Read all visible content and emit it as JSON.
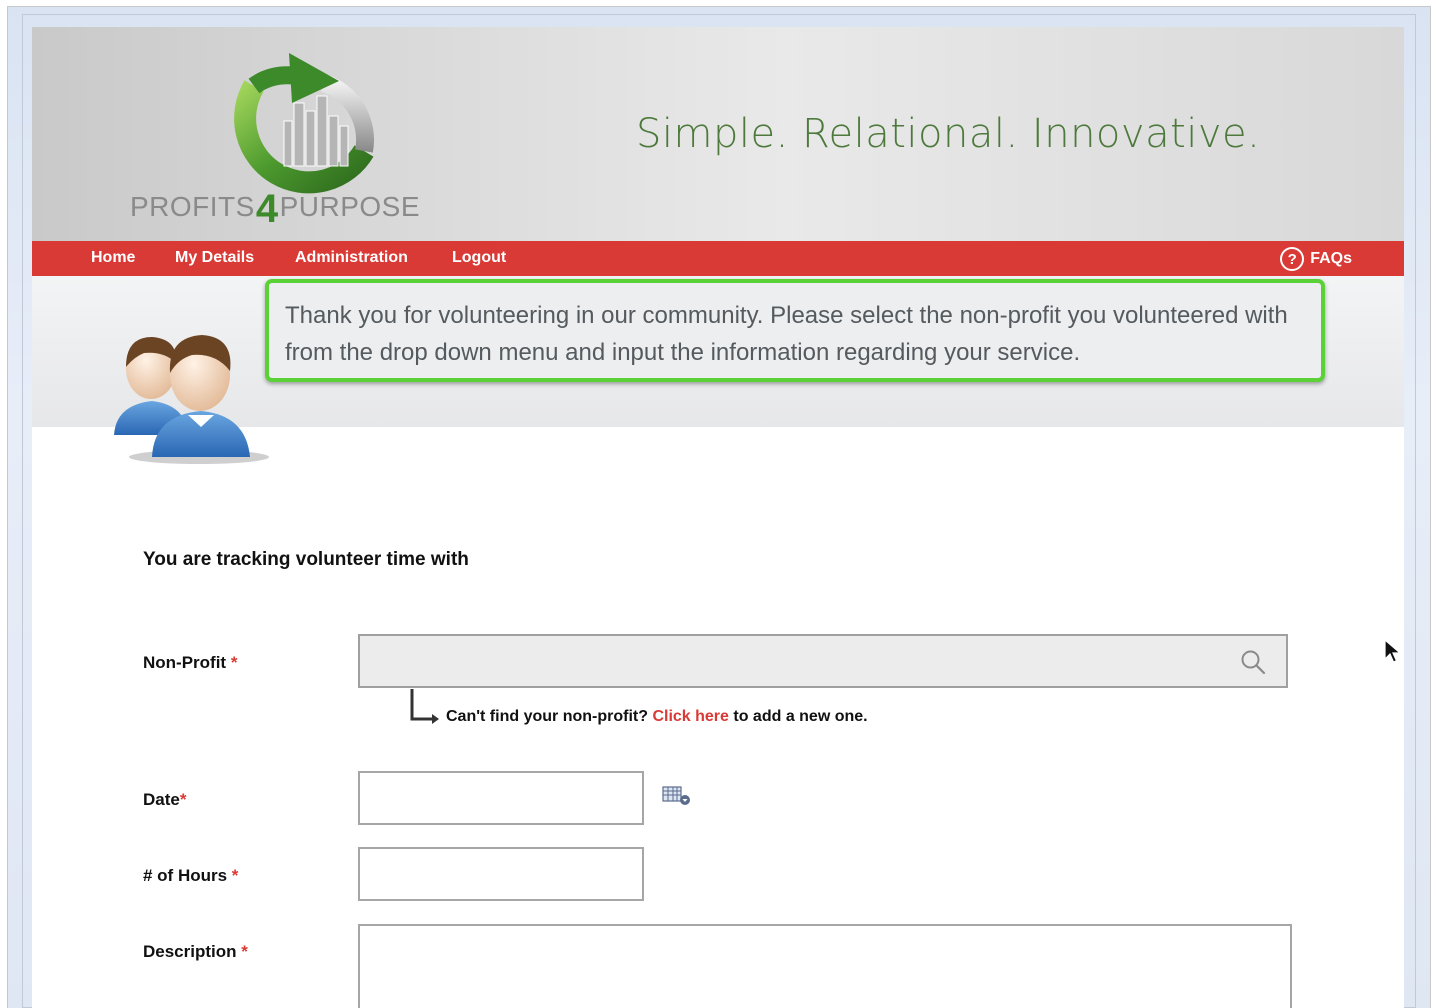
{
  "brand": {
    "logo_text_left": "PROFITS",
    "logo_text_four": "4",
    "logo_text_right": "PURPOSE",
    "tagline": "Simple. Relational. Innovative."
  },
  "nav": {
    "items": [
      {
        "label": "Home"
      },
      {
        "label": "My Details"
      },
      {
        "label": "Administration"
      },
      {
        "label": "Logout"
      }
    ],
    "faq_icon_glyph": "?",
    "faq_label": "FAQs"
  },
  "notice": {
    "text": "Thank you for volunteering in our community. Please select the non-profit you volunteered with from the drop down menu and input the information regarding your service."
  },
  "form": {
    "heading": "You are tracking volunteer time with",
    "nonprofit": {
      "label": "Non-Profit",
      "required_mark": "*",
      "value": ""
    },
    "hint": {
      "before": "Can't find your non-profit?",
      "link": "Click here",
      "after": "to add a new one."
    },
    "date": {
      "label": "Date",
      "required_mark": "*",
      "value": ""
    },
    "hours": {
      "label": "# of Hours",
      "required_mark": "*",
      "value": ""
    },
    "description": {
      "label": "Description",
      "required_mark": "*",
      "value": ""
    }
  },
  "colors": {
    "nav_red": "#d93a35",
    "notice_border": "#5ad137",
    "brand_green": "#4d7a3c"
  },
  "icons": [
    "logo-arrow-icon",
    "faq-help-icon",
    "users-avatar-icon",
    "search-icon",
    "calendar-icon",
    "mouse-cursor-icon"
  ]
}
